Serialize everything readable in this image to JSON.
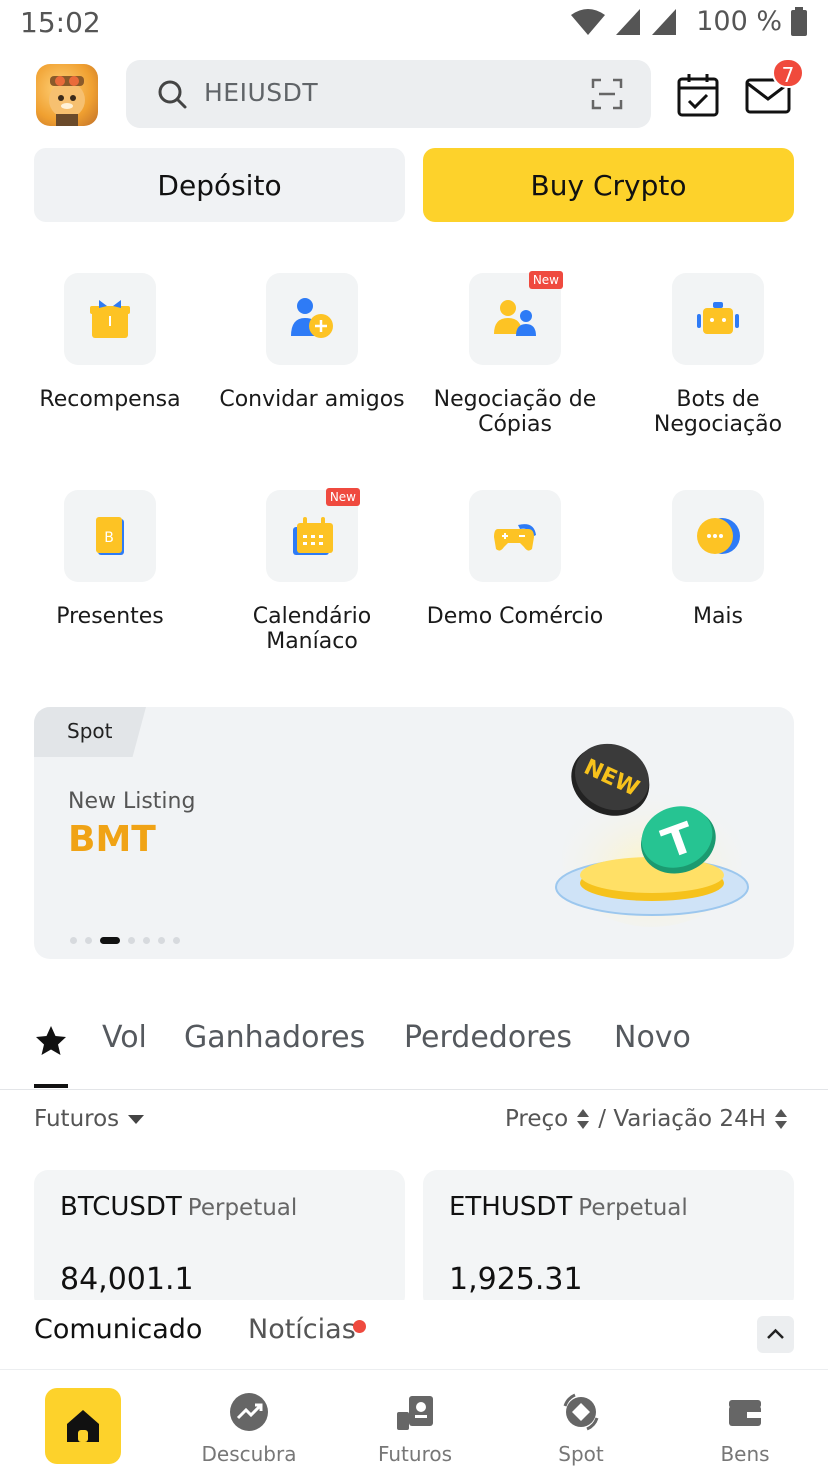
{
  "status_bar": {
    "time": "15:02",
    "battery": "100 %"
  },
  "header": {
    "search_placeholder": "HEIUSDT",
    "mail_badge": "7"
  },
  "actions": {
    "deposit_label": "Depósito",
    "buy_label": "Buy Crypto"
  },
  "shortcuts": [
    {
      "label": "Recompensa",
      "icon": "gift-icon"
    },
    {
      "label": "Convidar amigos",
      "icon": "invite-friends-icon"
    },
    {
      "label": "Negociação de Cópias",
      "icon": "copy-trading-icon",
      "tag": "New"
    },
    {
      "label": "Bots de Negociação",
      "icon": "trading-bot-icon"
    },
    {
      "label": "Presentes",
      "icon": "red-packet-icon"
    },
    {
      "label": "Calendário Maníaco",
      "icon": "calendar-icon",
      "tag": "New"
    },
    {
      "label": "Demo Comércio",
      "icon": "gamepad-icon"
    },
    {
      "label": "Mais",
      "icon": "more-icon"
    }
  ],
  "banner": {
    "tag": "Spot",
    "subtitle": "New Listing",
    "title": "BMT",
    "slide_total": 7,
    "slide_active": 3
  },
  "market_tabs": [
    "Vol",
    "Ganhadores",
    "Perdedores",
    "Novo"
  ],
  "filters": {
    "market": "Futuros",
    "price": "Preço",
    "change": "/ Variação 24H"
  },
  "tickers": [
    {
      "symbol": "BTCUSDT",
      "type": "Perpetual",
      "price": "84,001.1"
    },
    {
      "symbol": "ETHUSDT",
      "type": "Perpetual",
      "price": "1,925.31"
    }
  ],
  "news": {
    "tab1": "Comunicado",
    "tab2": "Notícias"
  },
  "bottom_nav": [
    {
      "label": "",
      "icon": "home-icon"
    },
    {
      "label": "Descubra",
      "icon": "discover-icon"
    },
    {
      "label": "Futuros",
      "icon": "futures-icon"
    },
    {
      "label": "Spot",
      "icon": "spot-icon"
    },
    {
      "label": "Bens",
      "icon": "wallet-icon"
    }
  ],
  "colors": {
    "brand_yellow": "#fdd22b",
    "accent_orange": "#f0a316",
    "badge_red": "#f04a3c"
  }
}
